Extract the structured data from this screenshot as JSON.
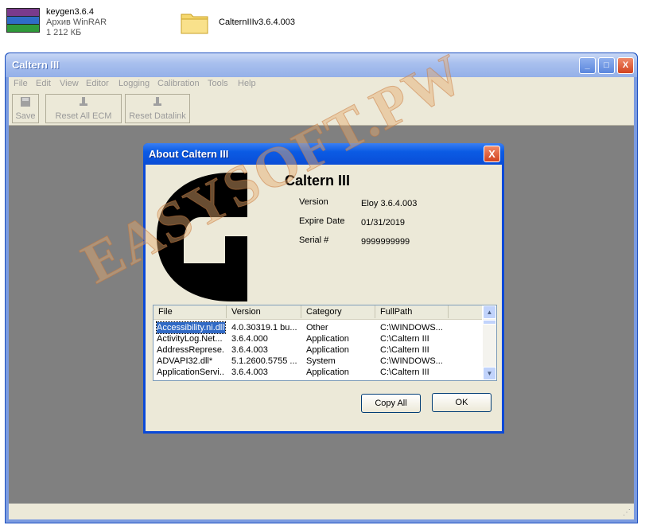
{
  "desktop": {
    "archive": {
      "name": "keygen3.6.4",
      "type": "Архив WinRAR",
      "size": "1 212 КБ"
    },
    "folder": {
      "name": "CalternIIIv3.6.4.003"
    }
  },
  "main_window": {
    "title": "Caltern III",
    "menu": [
      "File",
      "Edit",
      "View",
      "Editor",
      "Logging",
      "Calibration",
      "Tools",
      "Help"
    ],
    "toolbar": {
      "save": "Save",
      "reset_ecm": "Reset All ECM",
      "reset_datalink": "Reset Datalink"
    },
    "controls": {
      "minimize": "_",
      "maximize": "□",
      "close": "X"
    }
  },
  "about_dialog": {
    "title": "About Caltern III",
    "close": "X",
    "app_name": "Caltern III",
    "version_label": "Version",
    "version_value": "Eloy 3.6.4.003",
    "expire_label": "Expire Date",
    "expire_value": "01/31/2019",
    "serial_label": "Serial #",
    "serial_value": "9999999999",
    "list": {
      "columns": [
        "File",
        "Version",
        "Category",
        "FullPath"
      ],
      "rows": [
        [
          "Accessibility.ni.dll*",
          "4.0.30319.1 bu...",
          "Other",
          "C:\\WINDOWS..."
        ],
        [
          "ActivityLog.Net...",
          "3.6.4.000",
          "Application",
          "C:\\Caltern III"
        ],
        [
          "AddressReprese...",
          "3.6.4.003",
          "Application",
          "C:\\Caltern III"
        ],
        [
          "ADVAPI32.dll*",
          "5.1.2600.5755 ...",
          "System",
          "C:\\WINDOWS..."
        ],
        [
          "ApplicationServi...",
          "3.6.4.003",
          "Application",
          "C:\\Caltern III"
        ]
      ]
    },
    "copy_all": "Copy All",
    "ok": "OK"
  },
  "watermark": "EASYSOFT.PW",
  "colors": {
    "xp_title_blue": "#0a49d8",
    "xp_face": "#ece9d8",
    "client_gray": "#808080",
    "selection": "#316ac5"
  }
}
